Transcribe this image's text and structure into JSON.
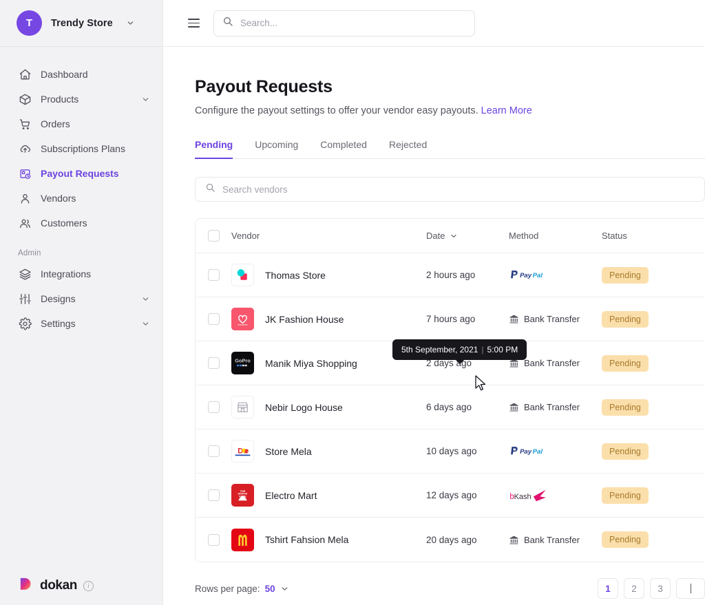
{
  "sidebar": {
    "brand": {
      "avatar_letter": "T",
      "name": "Trendy Store",
      "caret_icon": "chevron-down-icon"
    },
    "items": [
      {
        "label": "Dashboard",
        "icon": "home-icon",
        "active": false,
        "expandable": false
      },
      {
        "label": "Products",
        "icon": "box-icon",
        "active": false,
        "expandable": true
      },
      {
        "label": "Orders",
        "icon": "cart-icon",
        "active": false,
        "expandable": false
      },
      {
        "label": "Subscriptions Plans",
        "icon": "cloud-upload-icon",
        "active": false,
        "expandable": false
      },
      {
        "label": "Payout Requests",
        "icon": "payout-icon",
        "active": true,
        "expandable": false
      },
      {
        "label": "Vendors",
        "icon": "user-icon",
        "active": false,
        "expandable": false
      },
      {
        "label": "Customers",
        "icon": "users-icon",
        "active": false,
        "expandable": false
      }
    ],
    "admin_section_label": "Admin",
    "admin_items": [
      {
        "label": "Integrations",
        "icon": "layers-icon",
        "active": false,
        "expandable": false
      },
      {
        "label": "Designs",
        "icon": "sliders-icon",
        "active": false,
        "expandable": true
      },
      {
        "label": "Settings",
        "icon": "gear-icon",
        "active": false,
        "expandable": true
      }
    ],
    "footer": {
      "logo_text": "dokan",
      "info_icon": "info-icon"
    }
  },
  "topbar": {
    "menu_icon": "hamburger-icon",
    "search": {
      "placeholder": "Search...",
      "value": "",
      "icon": "search-icon"
    }
  },
  "page": {
    "title": "Payout Requests",
    "subtitle": "Configure the payout settings to offer your vendor easy payouts.",
    "learn_more": "Learn More"
  },
  "tabs": [
    {
      "label": "Pending",
      "active": true
    },
    {
      "label": "Upcoming",
      "active": false
    },
    {
      "label": "Completed",
      "active": false
    },
    {
      "label": "Rejected",
      "active": false
    }
  ],
  "vendor_search": {
    "placeholder": "Search vendors",
    "value": "",
    "icon": "search-icon"
  },
  "table": {
    "columns": {
      "vendor": "Vendor",
      "date": "Date",
      "method": "Method",
      "status": "Status"
    },
    "date_sort_icon": "chevron-down-icon",
    "rows": [
      {
        "vendor": "Thomas Store",
        "date": "2 hours ago",
        "method": "PayPal",
        "method_type": "paypal",
        "status": "Pending",
        "logo": "thomas-store-logo"
      },
      {
        "vendor": "JK Fashion House",
        "date": "7 hours ago",
        "method": "Bank Transfer",
        "method_type": "bank",
        "status": "Pending",
        "logo": "jk-fashion-house-logo"
      },
      {
        "vendor": "Manik Miya Shopping",
        "date": "2 days ago",
        "method": "Bank Transfer",
        "method_type": "bank",
        "status": "Pending",
        "logo": "manik-miya-shopping-logo"
      },
      {
        "vendor": "Nebir Logo House",
        "date": "6 days ago",
        "method": "Bank Transfer",
        "method_type": "bank",
        "status": "Pending",
        "logo": "nebir-logo-house-logo"
      },
      {
        "vendor": "Store Mela",
        "date": "10 days ago",
        "method": "PayPal",
        "method_type": "paypal",
        "status": "Pending",
        "logo": "store-mela-logo"
      },
      {
        "vendor": "Electro Mart",
        "date": "12 days ago",
        "method": "bKash",
        "method_type": "bkash",
        "status": "Pending",
        "logo": "electro-mart-logo"
      },
      {
        "vendor": "Tshirt Fahsion Mela",
        "date": "20 days ago",
        "method": "Bank Transfer",
        "method_type": "bank",
        "status": "Pending",
        "logo": "tshirt-fahsion-mela-logo"
      }
    ]
  },
  "tooltip": {
    "date": "5th September, 2021",
    "separator": "|",
    "time": "5:00 PM"
  },
  "footer": {
    "rows_per_page_label": "Rows per page:",
    "rows_per_page_value": "50",
    "rows_per_page_caret": "chevron-down-icon",
    "pages": [
      "1",
      "2",
      "3"
    ],
    "active_page": "1"
  },
  "colors": {
    "accent": "#6C43E0",
    "brand_avatar": "#7747E4",
    "badge_bg": "#FBDFAB",
    "badge_text": "#A97A2C",
    "sidebar_bg": "#F2F2F4",
    "tooltip_bg": "#17171C"
  }
}
